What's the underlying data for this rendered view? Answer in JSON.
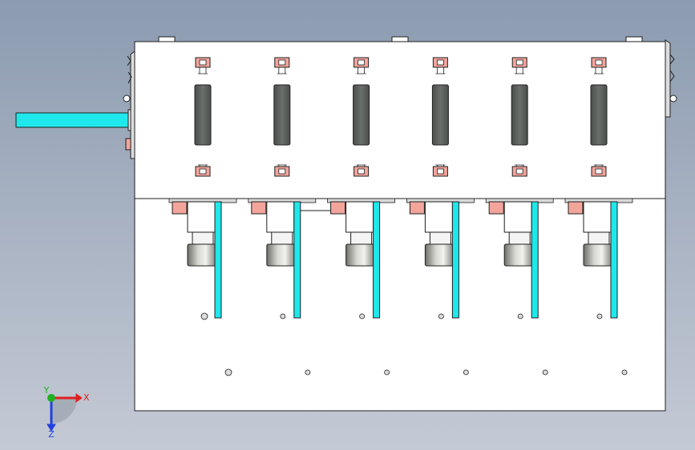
{
  "view": {
    "background_top": "#8c9bb0",
    "background_bottom": "#c4cad5",
    "plate_color": "#ffffff",
    "outline_color": "#1f1f1f"
  },
  "modules": {
    "count": 6,
    "slot_color": "#5a5f5b",
    "clip_color": "#f3a59c",
    "rod_color": "#2ee6e6",
    "cylinder_color": "#9a9a92",
    "shaft_color": "#1fe8ec"
  },
  "triad": {
    "x_label": "X",
    "y_label": "Y",
    "z_label": "Z",
    "x_color": "#e02020",
    "y_color": "#20b020",
    "z_color": "#2040e0"
  }
}
